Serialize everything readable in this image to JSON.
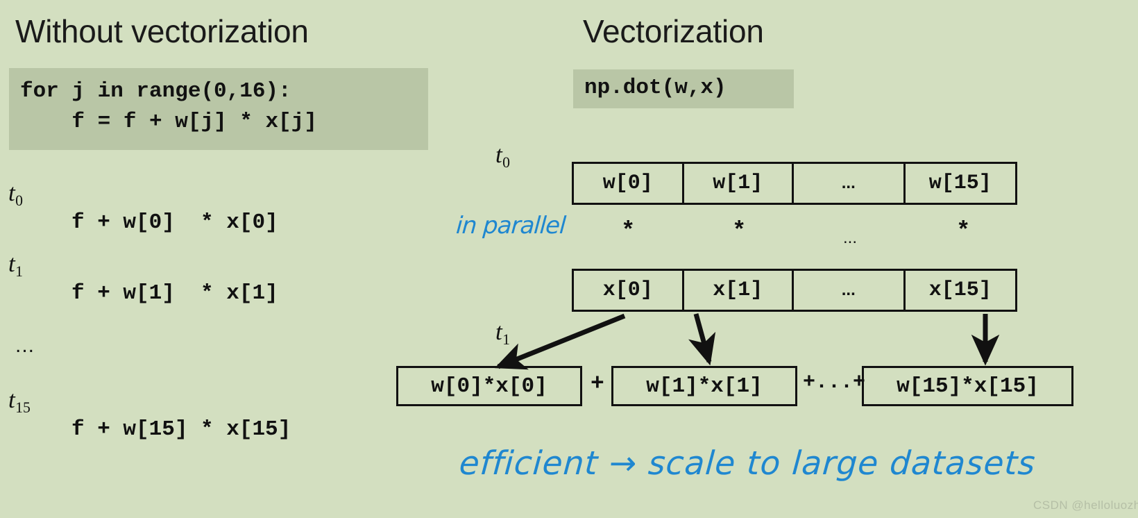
{
  "left": {
    "heading": "Without vectorization",
    "code": "for j in range(0,16):\n    f = f + w[j] * x[j]",
    "steps": [
      {
        "time": "t",
        "index": "0",
        "expr": "f + w[0]  * x[0]"
      },
      {
        "time": "t",
        "index": "1",
        "expr": "f + w[1]  * x[1]"
      },
      {
        "time": "t",
        "index": "15",
        "expr": "f + w[15] * x[15]"
      }
    ],
    "ellipsis": "..."
  },
  "right": {
    "heading": "Vectorization",
    "code": "np.dot(w,x)",
    "t0_label": {
      "time": "t",
      "index": "0"
    },
    "t1_label": {
      "time": "t",
      "index": "1"
    },
    "w_array": [
      "w[0]",
      "w[1]",
      "...",
      "w[15]"
    ],
    "x_array": [
      "x[0]",
      "x[1]",
      "...",
      "x[15]"
    ],
    "star_row": [
      "*",
      "*",
      "...",
      "*"
    ],
    "results": [
      "w[0]*x[0]",
      "w[1]*x[1]",
      "w[15]*x[15]"
    ],
    "separators": [
      "+",
      "+...+"
    ],
    "annotations": {
      "parallel": "in parallel",
      "efficient": "efficient → scale to large datasets"
    }
  },
  "watermark": "CSDN @helloluozhi",
  "colors": {
    "background": "#d3dfc0",
    "code_background": "#b9c6a6",
    "ink": "#111111",
    "handwriting": "#1f87d0",
    "watermark": "#b5bfa6"
  }
}
